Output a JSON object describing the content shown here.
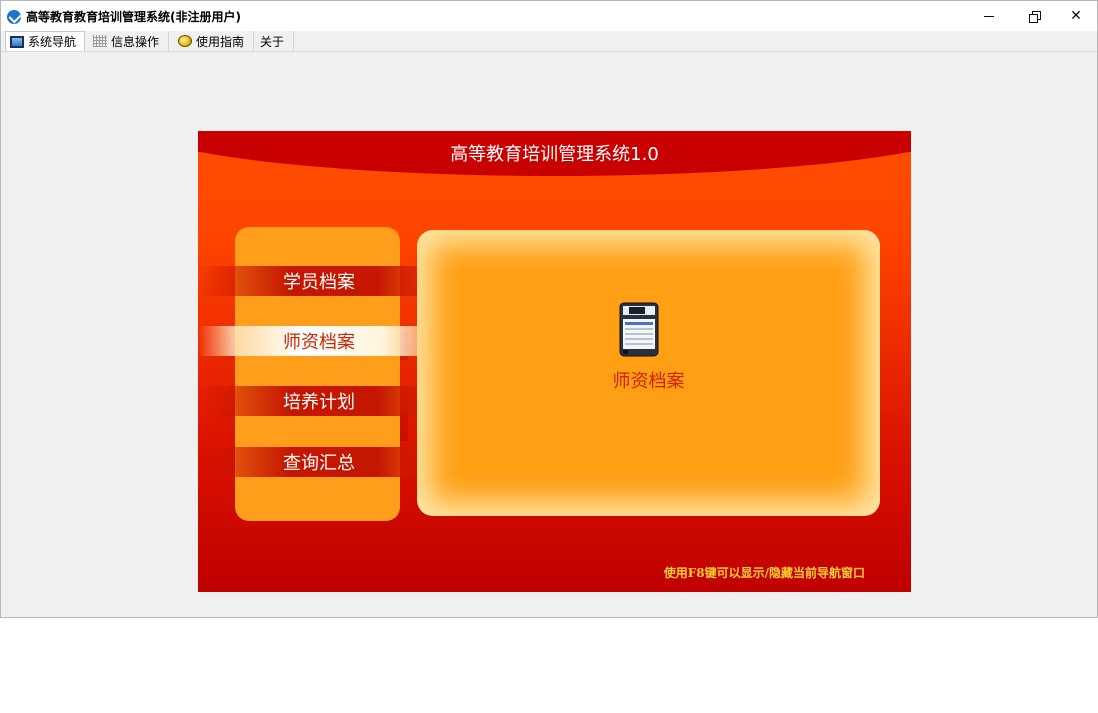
{
  "window": {
    "title": "高等教育教育培训管理系统(非注册用户)",
    "controls": {
      "minimize": "—",
      "maximize": "❐",
      "close": "✕"
    }
  },
  "tabs": [
    {
      "label": "系统导航",
      "icon": "monitor-icon",
      "active": true
    },
    {
      "label": "信息操作",
      "icon": "grid-icon",
      "active": false
    },
    {
      "label": "使用指南",
      "icon": "lightbulb-icon",
      "active": false
    },
    {
      "label": "关于",
      "icon": "",
      "active": false
    }
  ],
  "panel": {
    "title": "高等教育培训管理系统1.0",
    "menu": [
      {
        "label": "学员档案",
        "selected": false
      },
      {
        "label": "师资档案",
        "selected": true
      },
      {
        "label": "培养计划",
        "selected": false
      },
      {
        "label": "查询汇总",
        "selected": false
      }
    ],
    "content": {
      "icon": "floppy-disk-icon",
      "label": "师资档案"
    },
    "hint": "使用F8键可以显示/隐藏当前导航窗口"
  },
  "colors": {
    "accent_red": "#c90000",
    "accent_orange": "#ff9e1a",
    "hint_yellow": "#ffcc33"
  }
}
